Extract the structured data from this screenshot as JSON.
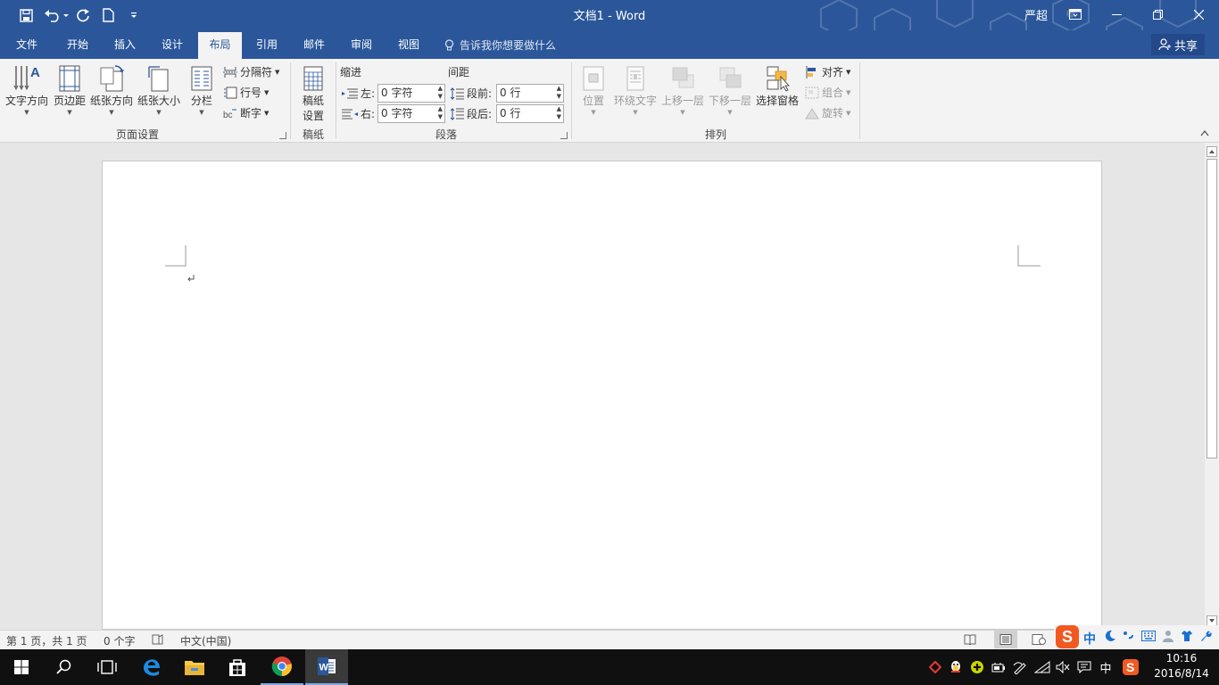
{
  "window": {
    "title": "文档1 - Word",
    "user": "严超",
    "minimize_icon": "minimize-icon",
    "restore_icon": "restore-icon",
    "close_icon": "close-icon"
  },
  "quick_access": {
    "save": "save-icon",
    "undo": "undo-icon",
    "redo": "redo-icon",
    "new": "new-document-icon",
    "customize": "customize-qat-icon"
  },
  "tabs": [
    {
      "label": "文件",
      "active": false
    },
    {
      "label": "开始",
      "active": false
    },
    {
      "label": "插入",
      "active": false
    },
    {
      "label": "设计",
      "active": false
    },
    {
      "label": "布局",
      "active": true
    },
    {
      "label": "引用",
      "active": false
    },
    {
      "label": "邮件",
      "active": false
    },
    {
      "label": "审阅",
      "active": false
    },
    {
      "label": "视图",
      "active": false
    }
  ],
  "tell_me": "告诉我你想要做什么",
  "share": "共享",
  "ribbon": {
    "page_setup": {
      "group_label": "页面设置",
      "text_direction": "文字方向",
      "margins": "页边距",
      "orientation": "纸张方向",
      "size": "纸张大小",
      "columns": "分栏",
      "breaks": "分隔符",
      "line_numbers": "行号",
      "hyphenation": "断字"
    },
    "manuscript": {
      "group_label": "稿纸",
      "button_line1": "稿纸",
      "button_line2": "设置"
    },
    "paragraph": {
      "group_label": "段落",
      "indent_heading": "缩进",
      "spacing_heading": "间距",
      "left_label": "左:",
      "right_label": "右:",
      "left_value": "0 字符",
      "right_value": "0 字符",
      "before_label": "段前:",
      "after_label": "段后:",
      "before_value": "0 行",
      "after_value": "0 行"
    },
    "arrange": {
      "group_label": "排列",
      "position": "位置",
      "wrap_text": "环绕文字",
      "bring_forward": "上移一层",
      "send_backward": "下移一层",
      "selection_pane": "选择窗格",
      "align": "对齐",
      "group": "组合",
      "rotate": "旋转"
    }
  },
  "status": {
    "page": "第 1 页，共 1 页",
    "words": "0 个字",
    "language": "中文(中国)"
  },
  "ime": {
    "mode": "中"
  },
  "taskbar": {
    "time": "10:16",
    "date": "2016/8/14",
    "ime_tray": "中"
  },
  "colors": {
    "word_blue": "#2b579a",
    "ribbon_bg": "#f3f3f3",
    "taskbar": "#101010"
  }
}
